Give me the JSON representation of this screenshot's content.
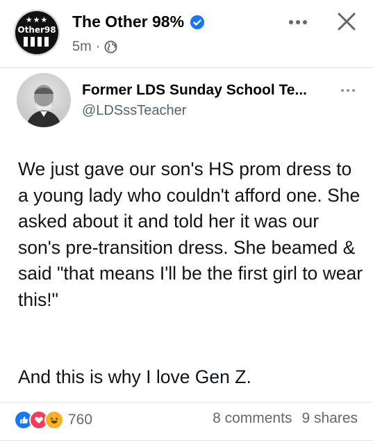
{
  "post": {
    "page_name": "The Other 98%",
    "page_avatar_text": "Other98",
    "timestamp": "5m",
    "separator": "·",
    "audience_icon": "globe-icon",
    "verified_icon": "verified-badge-icon"
  },
  "tweet": {
    "author_name": "Former LDS Sunday School Te...",
    "handle": "@LDSssTeacher",
    "body_p1": "We just gave our son's HS prom dress to a young lady who couldn't afford one. She asked about it and told her it was our son's pre-transition dress. She beamed & said \"that means I'll be the first girl to wear this!\"",
    "body_p2": "And this is why I love Gen Z."
  },
  "engagement": {
    "reaction_count": "760",
    "comments": "8 comments",
    "shares": "9 shares",
    "reaction_icons": [
      "like-icon",
      "love-icon",
      "haha-icon"
    ]
  },
  "colors": {
    "verified": "#1877f2",
    "like": "#1877f2",
    "love": "#f33e58",
    "haha": "#f7b125",
    "secondary_text": "#65676b"
  }
}
